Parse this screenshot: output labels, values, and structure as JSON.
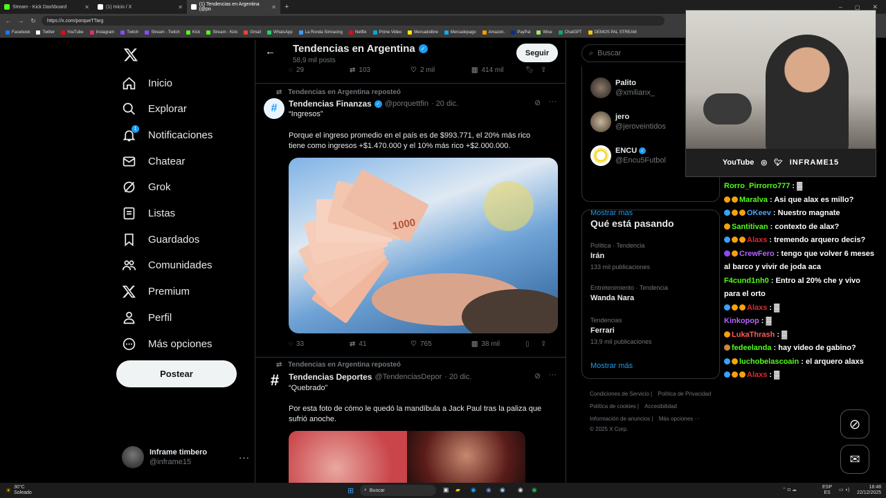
{
  "tabs": [
    {
      "label": "Stream - Kick Dashboard",
      "color": "#53fc18"
    },
    {
      "label": "(1) Inicio / X",
      "color": "#ffffff"
    },
    {
      "label": "(1) Tendencias en Argentina (@po",
      "color": "#ffffff"
    }
  ],
  "address": {
    "url": "https://x.com/porqueTTarg"
  },
  "bookmarks": [
    {
      "label": "Facebook",
      "color": "#1877f2"
    },
    {
      "label": "Twitter",
      "color": "#ffffff"
    },
    {
      "label": "YouTube",
      "color": "#ff0000"
    },
    {
      "label": "Instagram",
      "color": "#e1306c"
    },
    {
      "label": "Twitch",
      "color": "#9146ff"
    },
    {
      "label": "Stream - Twitch",
      "color": "#9146ff"
    },
    {
      "label": "Kick",
      "color": "#53fc18"
    },
    {
      "label": "Stream - Kick",
      "color": "#53fc18"
    },
    {
      "label": "Gmail",
      "color": "#ea4335"
    },
    {
      "label": "WhatsApp",
      "color": "#25d366"
    },
    {
      "label": "La Ronda Simracing",
      "color": "#3aa0ff"
    },
    {
      "label": "Netflix",
      "color": "#e50914"
    },
    {
      "label": "Prime Video",
      "color": "#00a8e1"
    },
    {
      "label": "Mercadolibre",
      "color": "#ffe600"
    },
    {
      "label": "Mercadopago",
      "color": "#00b1ea"
    },
    {
      "label": "Amazon.",
      "color": "#ff9900"
    },
    {
      "label": "PayPal",
      "color": "#003087"
    },
    {
      "label": "Wise",
      "color": "#9fe870"
    },
    {
      "label": "ChatGPT",
      "color": "#10a37f"
    },
    {
      "label": "DEMOS PAL STREAM",
      "color": "#f4c20d"
    }
  ],
  "nav": {
    "items": [
      {
        "label": "Inicio",
        "icon": "home-icon"
      },
      {
        "label": "Explorar",
        "icon": "search-icon"
      },
      {
        "label": "Notificaciones",
        "icon": "bell-icon",
        "badge": "1"
      },
      {
        "label": "Chatear",
        "icon": "mail-icon"
      },
      {
        "label": "Grok",
        "icon": "grok-icon"
      },
      {
        "label": "Listas",
        "icon": "list-icon"
      },
      {
        "label": "Guardados",
        "icon": "bookmark-icon"
      },
      {
        "label": "Comunidades",
        "icon": "people-icon"
      },
      {
        "label": "Premium",
        "icon": "x-logo-icon"
      },
      {
        "label": "Perfil",
        "icon": "person-icon"
      },
      {
        "label": "Más opciones",
        "icon": "more-circle-icon"
      }
    ],
    "post_label": "Postear",
    "account": {
      "name": "Inframe timbero",
      "handle": "@inframe15"
    }
  },
  "header": {
    "title": "Tendencias en Argentina",
    "subtitle": "58,9 mil posts",
    "follow_label": "Seguir"
  },
  "prev_actions": {
    "replies": "29",
    "reposts": "103",
    "likes": "2 mil",
    "views": "414 mil"
  },
  "post1": {
    "repost_label": "Tendencias en Argentina reposteó",
    "author": "Tendencias Finanzas",
    "handle": "@porquettfin",
    "date": "· 20 dic.",
    "quote": "“Ingresos”",
    "text": "Porque el ingreso promedio en el país es de $993.771, el 20% más rico tiene como ingresos +$1.470.000 y el 10% más rico +$2.000.000.",
    "banknote": "1000",
    "replies": "33",
    "reposts": "41",
    "likes": "765",
    "views": "38 mil"
  },
  "post2": {
    "repost_label": "Tendencias en Argentina reposteó",
    "author": "Tendencias Deportes",
    "handle": "@TendenciasDepor",
    "date": "· 20 dic.",
    "quote": "“Quebrado”",
    "text": "Por esta foto de cómo le quedó la mandíbula a Jack Paul tras la paliza que sufrió anoche."
  },
  "search": {
    "placeholder": "Buscar"
  },
  "who_to_follow": [
    {
      "name": "Palito",
      "handle": "@xmilianx_"
    },
    {
      "name": "jero",
      "handle": "@jeroveintidos"
    },
    {
      "name": "ENCU",
      "handle": "@Encu5Futbol"
    }
  ],
  "show_more": "Mostrar más",
  "happening": {
    "title": "Qué está pasando",
    "trends": [
      {
        "category": "Política · Tendencia",
        "name": "Irán",
        "count": "133 mil publicaciones"
      },
      {
        "category": "Entretenimiento · Tendencia",
        "name": "Wanda Nara",
        "count": ""
      },
      {
        "category": "Tendencias",
        "name": "Ferrari",
        "count": "13,9 mil publicaciones"
      }
    ],
    "show_more": "Mostrar más"
  },
  "footer": {
    "line1a": "Condiciones de Servicio",
    "line1b": "Política de Privacidad",
    "line2a": "Política de cookies",
    "line2b": "Accesibilidad",
    "line3a": "Información de anuncios",
    "line3b": "Más opciones ···",
    "copy": "© 2025 X Corp."
  },
  "webcam": {
    "youtube": "YouTube",
    "handle": "INFRAME15"
  },
  "chat": [
    {
      "user": "Rorro_Pirrorro777",
      "msg": " : ▓",
      "color": "#53fc18",
      "badges": []
    },
    {
      "user": "Maralva",
      "msg": " : Asi que alax es millo?",
      "color": "#53fc18",
      "badges": [
        "#f4a20d",
        "#f4a20d"
      ]
    },
    {
      "user": "OKeev",
      "msg": " : Nuestro magnate",
      "color": "#4aa3ff",
      "badges": [
        "#3aa0ff",
        "#f4a20d",
        "#f4a20d"
      ]
    },
    {
      "user": "Santitivan",
      "msg": " : contexto de alax?",
      "color": "#53fc18",
      "badges": [
        "#f4a20d"
      ]
    },
    {
      "user": "Alaxs",
      "msg": " : tremendo arquero decis?",
      "color": "#e0282e",
      "badges": [
        "#3aa0ff",
        "#f4a20d",
        "#f4a20d"
      ]
    },
    {
      "user": "CrewFero",
      "msg": " : tengo que volver 6 meses al barco y vivir de joda aca",
      "color": "#b265ff",
      "badges": [
        "#8a4af3",
        "#f4a20d"
      ]
    },
    {
      "user": "F4cund1nh0",
      "msg": " : Entro al 20% che y vivo para el orto",
      "color": "#53fc18",
      "badges": []
    },
    {
      "user": "Alaxs",
      "msg": " : ▓",
      "color": "#e0282e",
      "badges": [
        "#3aa0ff",
        "#f4a20d",
        "#f4a20d"
      ]
    },
    {
      "user": "Kinkopop",
      "msg": " : ▓",
      "color": "#b265ff",
      "badges": []
    },
    {
      "user": "LukaThrash",
      "msg": " : ▓",
      "color": "#ff5a5a",
      "badges": [
        "#f4a20d"
      ]
    },
    {
      "user": "fedeelanda",
      "msg": " : hay video de gabino?",
      "color": "#53fc18",
      "badges": [
        "#c98a3a"
      ]
    },
    {
      "user": "luchobelascoain",
      "msg": " : el arquero alaxs",
      "color": "#53fc18",
      "badges": [
        "#3aa0ff",
        "#f4a20d"
      ]
    },
    {
      "user": "Alaxs",
      "msg": " : ▓",
      "color": "#e0282e",
      "badges": [
        "#3aa0ff",
        "#f4a20d",
        "#f4a20d"
      ]
    }
  ],
  "taskbar": {
    "weather_temp": "30°C",
    "weather_text": "Soleado",
    "search": "Buscar",
    "lang1": "ESP",
    "lang2": "ES",
    "time": "18:48",
    "date": "22/12/2025"
  }
}
